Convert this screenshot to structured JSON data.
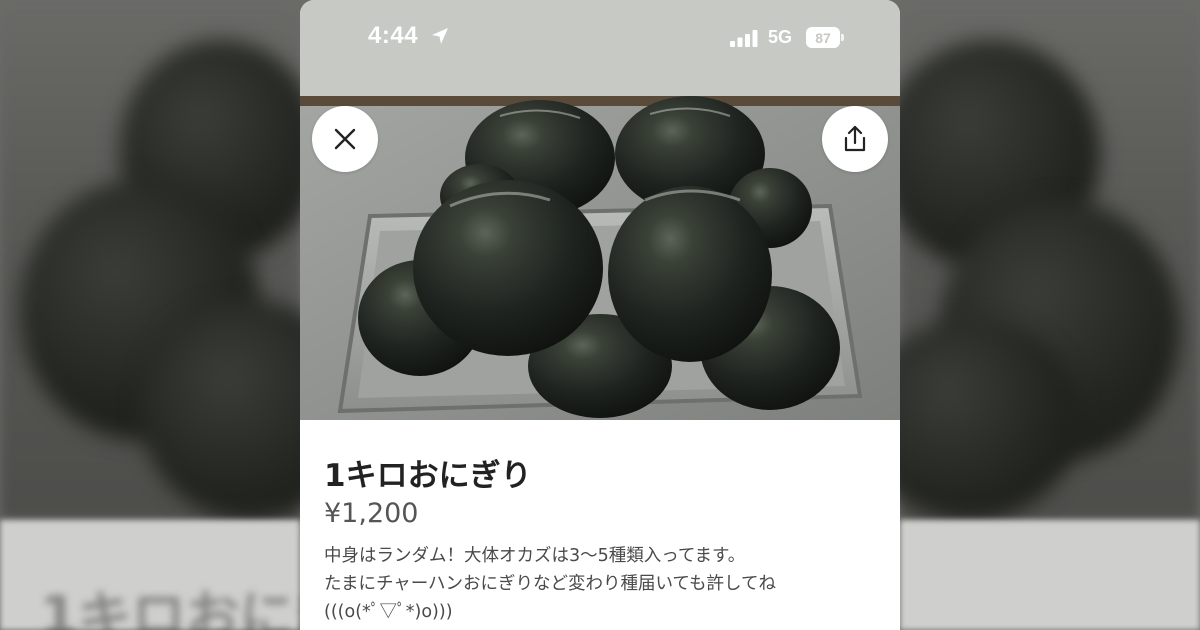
{
  "status_bar": {
    "time": "4:44",
    "network": "5G",
    "battery": "87"
  },
  "listing": {
    "title": "1キロおにぎり",
    "price": "¥1,200",
    "description": [
      "中身はランダム！大体オカズは3〜5種類入ってます。",
      "たまにチャーハンおにぎりなど変わり種届いても許してね",
      "(((o(*ﾟ▽ﾟ*)o)))"
    ]
  },
  "icons": {
    "close": "close-icon",
    "share": "share-icon",
    "location": "location-arrow-icon",
    "signal": "signal-bars-icon"
  },
  "colors": {
    "status_bar_bg": "#c7c9c4",
    "text_primary": "#222222",
    "text_secondary": "#555555"
  }
}
